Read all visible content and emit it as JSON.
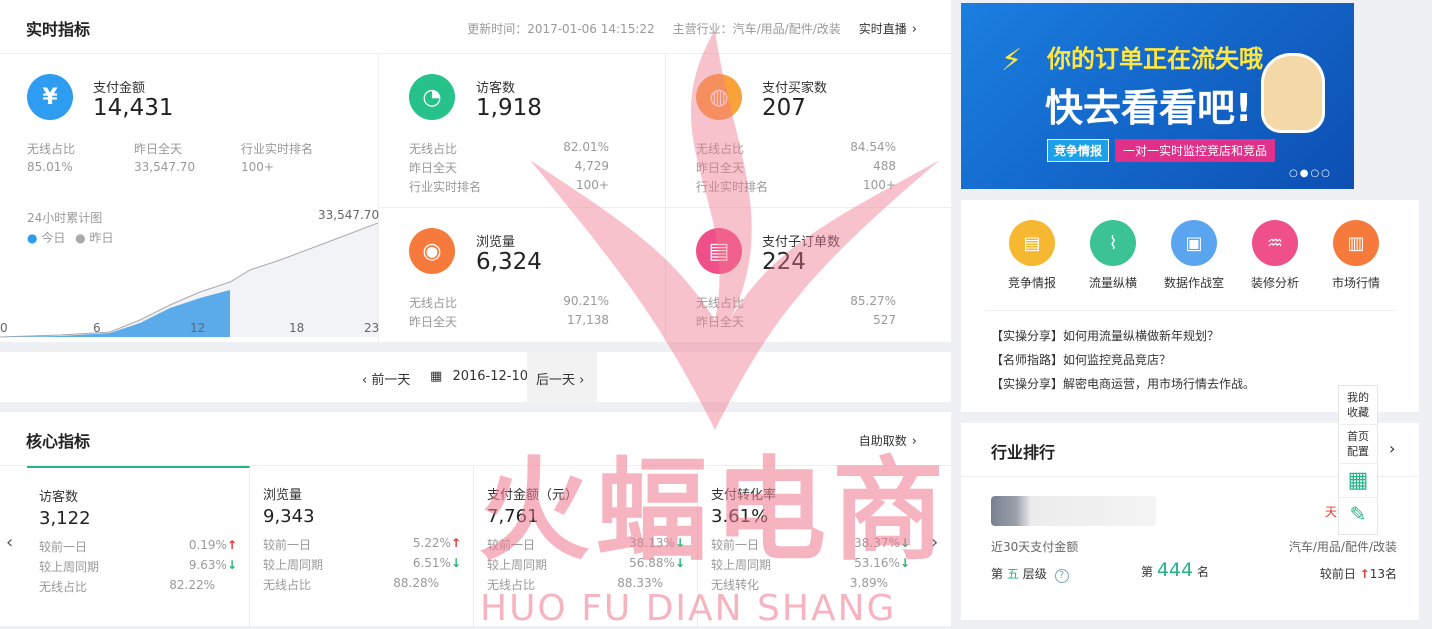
{
  "realtime": {
    "title": "实时指标",
    "update_time": "更新时间：2017-01-06 14:15:22",
    "industry": "主营行业：汽车/用品/配件/改装",
    "live_link": "实时直播",
    "payment": {
      "label": "支付金额",
      "value": "14,431",
      "sub_labels": [
        "无线占比",
        "昨日全天",
        "行业实时排名"
      ],
      "sub_values": [
        "85.01%",
        "33,547.70",
        "100+"
      ]
    },
    "chart": {
      "title": "24小时累计图",
      "legend_today": "今日",
      "legend_yesterday": "昨日",
      "max_label": "33,547.70",
      "x_ticks": [
        "0",
        "6",
        "12",
        "18",
        "23"
      ]
    },
    "metrics": [
      {
        "label": "访客数",
        "value": "1,918",
        "rows": [
          [
            "无线占比",
            "82.01%"
          ],
          [
            "昨日全天",
            "4,729"
          ],
          [
            "行业实时排名",
            "100+"
          ]
        ]
      },
      {
        "label": "支付买家数",
        "value": "207",
        "rows": [
          [
            "无线占比",
            "84.54%"
          ],
          [
            "昨日全天",
            "488"
          ],
          [
            "行业实时排名",
            "100+"
          ]
        ]
      },
      {
        "label": "浏览量",
        "value": "6,324",
        "rows": [
          [
            "无线占比",
            "90.21%"
          ],
          [
            "昨日全天",
            "17,138"
          ]
        ]
      },
      {
        "label": "支付子订单数",
        "value": "224",
        "rows": [
          [
            "无线占比",
            "85.27%"
          ],
          [
            "昨日全天",
            "527"
          ]
        ]
      }
    ]
  },
  "date_nav": {
    "prev": "前一天",
    "date": "2016-12-10",
    "next": "后一天"
  },
  "core": {
    "title": "核心指标",
    "custom_link": "自助取数",
    "cards": [
      {
        "label": "访客数",
        "value": "3,122",
        "r1": [
          "较前一日",
          "0.19%"
        ],
        "r2": [
          "较上周同期",
          "9.63%"
        ],
        "r3": [
          "无线占比",
          "82.22%"
        ]
      },
      {
        "label": "浏览量",
        "value": "9,343",
        "r1": [
          "较前一日",
          "5.22%"
        ],
        "r2": [
          "较上周同期",
          "6.51%"
        ],
        "r3": [
          "无线占比",
          "88.28%"
        ]
      },
      {
        "label": "支付金额（元）",
        "value": "7,761",
        "r1": [
          "较前一日",
          "38.13%"
        ],
        "r2": [
          "较上周同期",
          "56.88%"
        ],
        "r3": [
          "无线占比",
          "88.33%"
        ]
      },
      {
        "label": "支付转化率",
        "value": "3.61%",
        "r1": [
          "较前一日",
          "38.37%"
        ],
        "r2": [
          "较上周同期",
          "53.16%"
        ],
        "r3": [
          "无线转化",
          "3.89%"
        ]
      }
    ]
  },
  "banner": {
    "line1": "你的订单正在流失哦",
    "line2": "快去看看吧!",
    "tag": "竞争情报",
    "sub": "一对一实时监控竞店和竞品"
  },
  "tools": [
    {
      "label": "竞争情报",
      "color": "#f5b830"
    },
    {
      "label": "流量纵横",
      "color": "#3cc395"
    },
    {
      "label": "数据作战室",
      "color": "#5aa4f0"
    },
    {
      "label": "装修分析",
      "color": "#f0508a"
    },
    {
      "label": "市场行情",
      "color": "#f57a3c"
    }
  ],
  "articles": [
    "【实操分享】如何用流量纵横做新年规划？",
    "【名师指路】如何监控竞品竞店？",
    "【实操分享】解密电商运营，用市场行情去作战。"
  ],
  "ranking": {
    "title": "行业排行",
    "tmall": "天猫",
    "desc": "近30天支付金额",
    "industry": "汽车/用品/配件/改装",
    "level_prefix": "第",
    "level_value": "五",
    "level_suffix": "层级",
    "rank_prefix": "第",
    "rank_value": "444",
    "rank_suffix": "名",
    "compare_label": "较前日",
    "compare_value": "13名"
  },
  "sidebar": {
    "favorites": "我的收藏",
    "home_config": "首页配置"
  },
  "watermark": {
    "cn": "火蝠电商",
    "en": "HUO FU DIAN SHANG"
  }
}
